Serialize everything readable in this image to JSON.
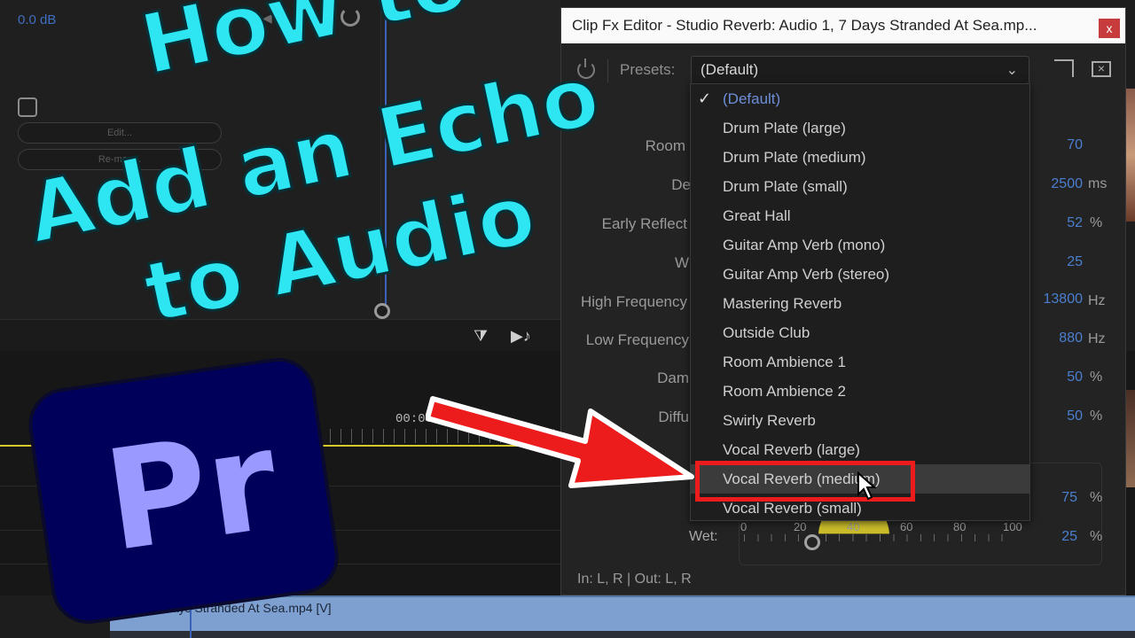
{
  "background": {
    "db_readout": "0.0 dB",
    "edit_button": "Edit...",
    "remap_button": "Re-map...",
    "timecode_left": "0",
    "timecode": "00:00:10:0",
    "clip_name": "7 Days Stranded At Sea.mp4 [V]"
  },
  "thumbnail": {
    "line1": "How to",
    "line2": "Add an Echo",
    "line3": "to Audio",
    "logo_text": "Pr",
    "title_color": "#2ee6f2",
    "logo_bg": "#00005b",
    "logo_fg": "#9999ff",
    "highlight_color": "#ec1c1c"
  },
  "fx_editor": {
    "title": "Clip Fx Editor - Studio Reverb: Audio 1, 7 Days Stranded At Sea.mp...",
    "close": "x",
    "presets_label": "Presets:",
    "presets_value": "(Default)",
    "params": [
      {
        "label": "Room",
        "value": "70",
        "unit": ""
      },
      {
        "label": "De",
        "value": "2500",
        "unit": "ms"
      },
      {
        "label": "Early Reflect",
        "value": "52",
        "unit": "%"
      },
      {
        "label": "W",
        "value": "25",
        "unit": ""
      },
      {
        "label": "High Frequency",
        "value": "13800",
        "unit": "Hz"
      },
      {
        "label": "Low Frequency",
        "value": "880",
        "unit": "Hz"
      },
      {
        "label": "Dam",
        "value": "50",
        "unit": "%"
      },
      {
        "label": "Diffu",
        "value": "50",
        "unit": "%"
      }
    ],
    "mix": {
      "dry_value": "75",
      "dry_unit": "%",
      "wet_label": "Wet:",
      "wet_value": "25",
      "wet_unit": "%",
      "scale": [
        "0",
        "20",
        "40",
        "60",
        "80",
        "100"
      ]
    },
    "io": "In: L, R | Out: L, R"
  },
  "dropdown": {
    "items": [
      "(Default)",
      "Drum Plate (large)",
      "Drum Plate (medium)",
      "Drum Plate (small)",
      "Great Hall",
      "Guitar Amp Verb (mono)",
      "Guitar Amp Verb (stereo)",
      "Mastering Reverb",
      "Outside Club",
      "Room Ambience 1",
      "Room Ambience 2",
      "Swirly Reverb",
      "Vocal Reverb (large)",
      "Vocal Reverb (medium)",
      "Vocal Reverb (small)"
    ],
    "selected": "(Default)",
    "highlighted": "Vocal Reverb (medium)",
    "check_glyph": "✓"
  }
}
